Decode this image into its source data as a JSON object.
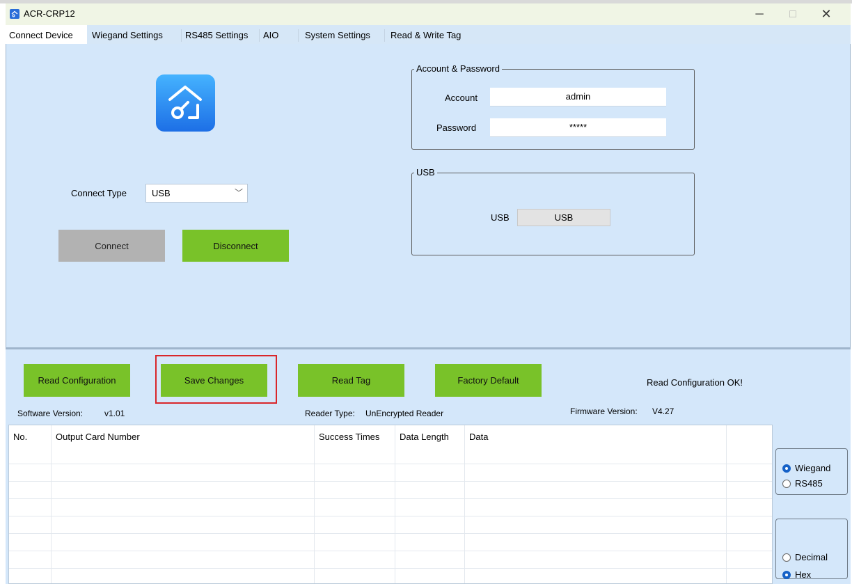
{
  "window": {
    "title": "ACR-CRP12",
    "minimize": "─",
    "maximize": "□",
    "close": "✕"
  },
  "tabs": [
    "Connect Device",
    "Wiegand Settings",
    "RS485 Settings",
    "AIO",
    "System Settings",
    "Read & Write Tag"
  ],
  "connect": {
    "type_label": "Connect Type",
    "type_value": "USB",
    "connect_label": "Connect",
    "disconnect_label": "Disconnect"
  },
  "account": {
    "group_title": "Account & Password",
    "account_label": "Account",
    "account_value": "admin",
    "password_label": "Password",
    "password_value": "*****"
  },
  "usb": {
    "group_title": "USB",
    "label": "USB",
    "button": "USB"
  },
  "actions": {
    "read_config": "Read Configuration",
    "save_changes": "Save Changes",
    "read_tag": "Read Tag",
    "factory_default": "Factory Default",
    "status": "Read Configuration OK!"
  },
  "info": {
    "software_label": "Software Version:",
    "software_value": "v1.01",
    "reader_label": "Reader Type:",
    "reader_value": "UnEncrypted Reader",
    "firmware_label": "Firmware Version:",
    "firmware_value": "V4.27"
  },
  "table": {
    "columns": [
      "No.",
      "Output Card Number",
      "Success Times",
      "Data Length",
      "Data"
    ]
  },
  "protocol": {
    "options": [
      "Wiegand",
      "RS485"
    ],
    "selected": "Wiegand"
  },
  "format": {
    "options": [
      "Decimal",
      "Hex"
    ],
    "selected": "Hex"
  },
  "colors": {
    "button_green": "#79c229",
    "panel_bg": "#d4e7fa",
    "highlight": "#d9262a",
    "radio_selected": "#1561c7"
  }
}
